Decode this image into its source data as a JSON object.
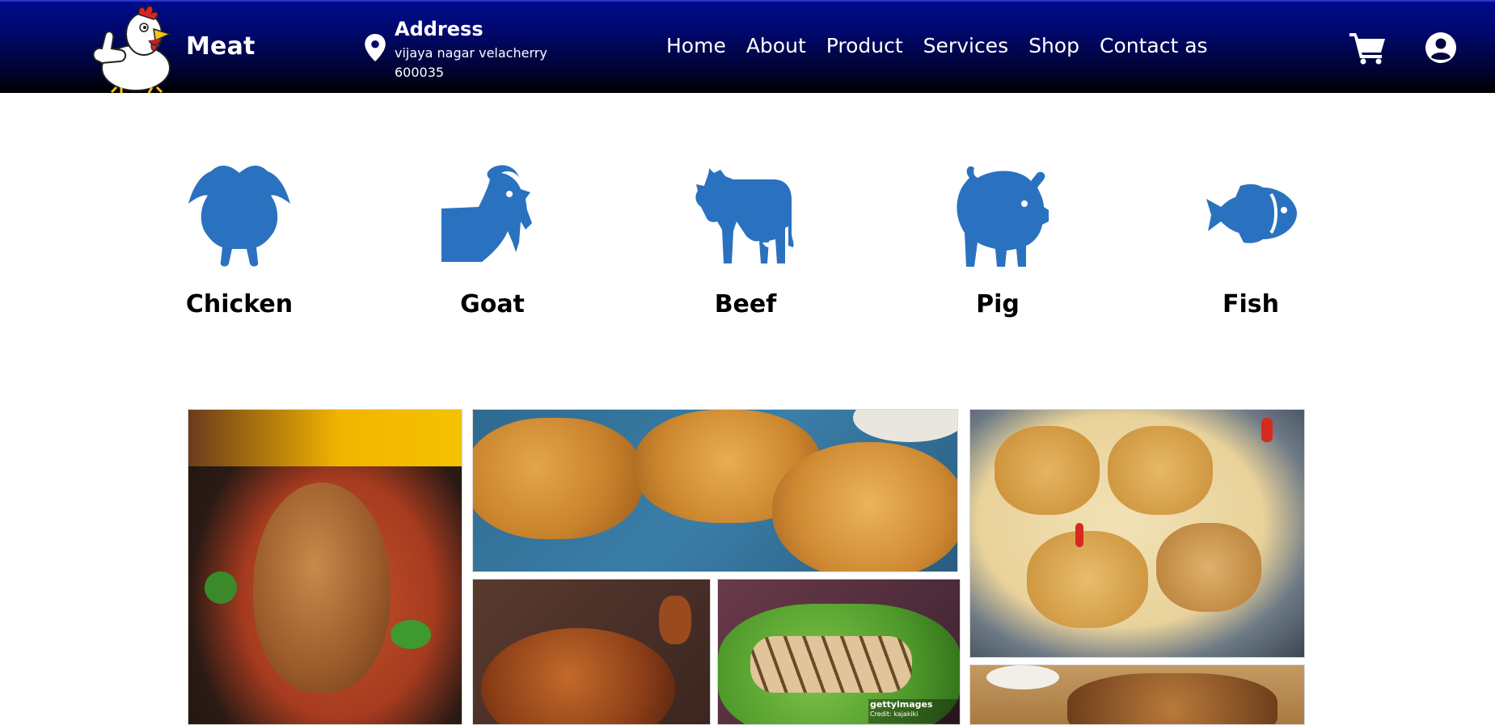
{
  "header": {
    "brand": "Meat",
    "address": {
      "title": "Address",
      "line1": "vijaya nagar velacherry",
      "line2": "600035"
    },
    "nav": [
      {
        "label": "Home"
      },
      {
        "label": "About"
      },
      {
        "label": "Product"
      },
      {
        "label": "Services"
      },
      {
        "label": "Shop"
      },
      {
        "label": "Contact as"
      }
    ],
    "icons": {
      "cart": "shopping-cart-icon",
      "account": "user-circle-icon",
      "location": "map-pin-icon"
    }
  },
  "categories": [
    {
      "label": "Chicken",
      "icon": "chicken-icon"
    },
    {
      "label": "Goat",
      "icon": "goat-icon"
    },
    {
      "label": "Beef",
      "icon": "cow-icon"
    },
    {
      "label": "Pig",
      "icon": "pig-icon"
    },
    {
      "label": "Fish",
      "icon": "fish-icon"
    }
  ],
  "gallery": {
    "watermark": "gettyimages",
    "watermark_credit": "Credit: kajakiki"
  },
  "colors": {
    "header_top": "#000b8c",
    "header_bottom": "#000000",
    "icon_blue": "#2a72c0",
    "text": "#000000"
  }
}
